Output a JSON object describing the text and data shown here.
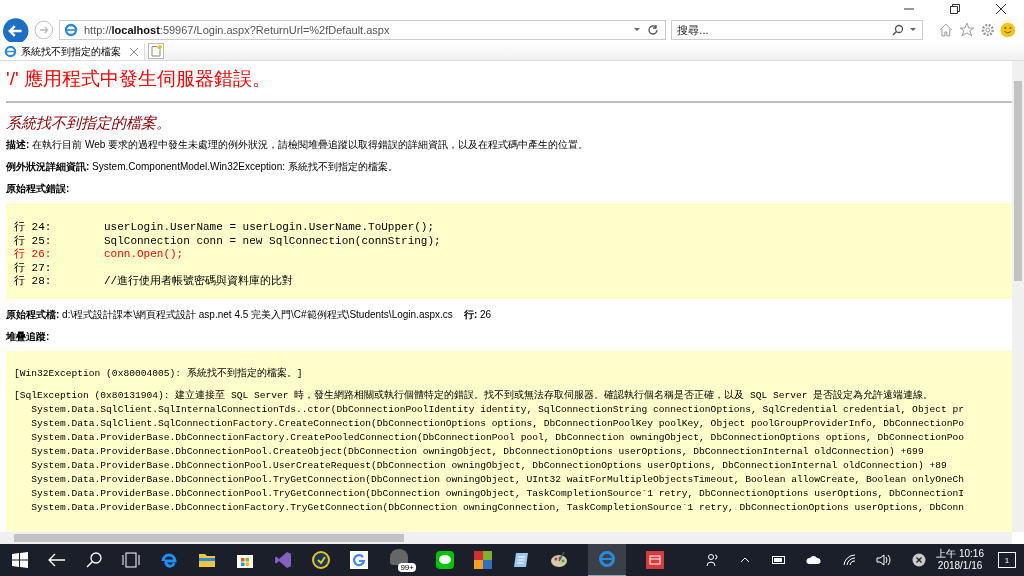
{
  "browser": {
    "address": "http://**localhost**:59967/Login.aspx?ReturnUrl=%2fDefault.aspx",
    "search": {
      "placeholder": "搜尋..."
    },
    "tabs": [
      {
        "title": "系統找不到指定的檔案",
        "selected": true
      }
    ]
  },
  "page": {
    "heading": "'/' 應用程式中發生伺服器錯誤。",
    "subheading": "系統找不到指定的檔案。",
    "paragraphs": [
      "**描述:** 在執行目前 Web 要求的過程中發生未處理的例外狀況，請檢閱堆疊追蹤以取得錯誤的詳細資訊，以及在程式碼中產生的位置。",
      "**例外狀況詳細資訊:** System.ComponentModel.Win32Exception: 系統找不到指定的檔案。"
    ],
    "source_error_label": "原始程式錯誤:",
    "code_lines": [
      {
        "number": "行 24:",
        "code": "userLogin.UserName = userLogin.UserName.ToUpper();",
        "error": false
      },
      {
        "number": "行 25:",
        "code": "SqlConnection conn = new SqlConnection(connString);",
        "error": false
      },
      {
        "number": "行 26:",
        "code": "conn.Open();",
        "error": true
      },
      {
        "number": "行 27:",
        "error": false
      },
      {
        "number": "行 28:",
        "code": "//進行使用者帳號密碼與資料庫的比對",
        "error": false
      }
    ],
    "source_file": "**原始程式檔:** d:\\程式設計課本\\網頁程式設計 asp.net 4.5 完美入門\\C#範例程式\\Students\\Login.aspx.cs    **行:** 26",
    "stack_label": "堆疊追蹤:",
    "stack_lines": [
      "[Win32Exception (0x80004005): 系統找不到指定的檔案。]",
      "[SqlException (0x80131904): 建立連接至 SQL Server 時，發生網路相關或執行個體特定的錯誤。找不到或無法存取伺服器。確認執行個名稱是否正確，以及 SQL Server 是否設定為允許遠端連線。",
      "   System.Data.SqlClient.SqlInternalConnectionTds..ctor(DbConnectionPoolIdentity identity, SqlConnectionString connectionOptions, SqlCredential credential, Object pr",
      "   System.Data.SqlClient.SqlConnectionFactory.CreateConnection(DbConnectionOptions options, DbConnectionPoolKey poolKey, Object poolGroupProviderInfo, DbConnectionPo",
      "   System.Data.ProviderBase.DbConnectionFactory.CreatePooledConnection(DbConnectionPool pool, DbConnection owningObject, DbConnectionOptions options, DbConnectionPoo",
      "   System.Data.ProviderBase.DbConnectionPool.CreateObject(DbConnection owningObject, DbConnectionOptions userOptions, DbConnectionInternal oldConnection) +699",
      "   System.Data.ProviderBase.DbConnectionPool.UserCreateRequest(DbConnection owningObject, DbConnectionOptions userOptions, DbConnectionInternal oldConnection) +89",
      "   System.Data.ProviderBase.DbConnectionPool.TryGetConnection(DbConnection owningObject, UInt32 waitForMultipleObjectsTimeout, Boolean allowCreate, Boolean onlyOneCh",
      "   System.Data.ProviderBase.DbConnectionPool.TryGetConnection(DbConnection owningObject, TaskCompletionSource`1 retry, DbConnectionOptions userOptions, DbConnectionI",
      "   System.Data.ProviderBase.DbConnectionFactory.TryGetConnection(DbConnection owningConnection, TaskCompletionSource`1 retry, DbConnectionOptions userOptions, DbConn"
    ]
  },
  "taskbar": {
    "badge": "99+",
    "time": "上午 10:16",
    "date": "2018/1/16",
    "notification_count": "1"
  }
}
